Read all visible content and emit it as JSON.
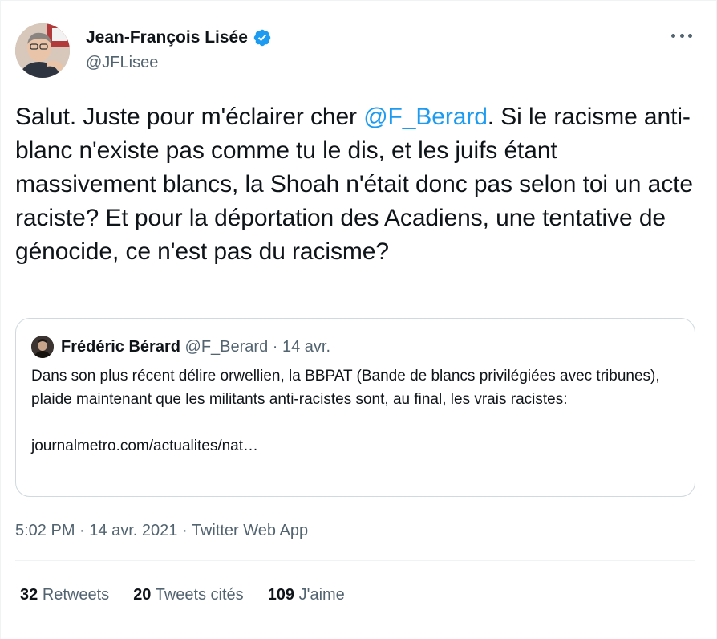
{
  "author": {
    "name": "Jean-François Lisée",
    "handle": "@JFLisee",
    "verified_icon": "verified-badge-icon",
    "verified_color": "#1d9bf0"
  },
  "tweet": {
    "text_before": "Salut. Juste pour m'éclairer cher ",
    "mention": "@F_Berard",
    "text_after": ". Si le racisme anti-blanc n'existe pas comme tu le dis, et les juifs étant massivement blancs, la Shoah n'était donc pas selon toi un acte raciste? Et pour la déportation des Acadiens, une tentative de génocide, ce n'est pas du racisme?"
  },
  "quote": {
    "name": "Frédéric Bérard",
    "handle": "@F_Berard",
    "separator": "·",
    "date": "14 avr.",
    "text": "Dans son plus récent délire orwellien, la BBPAT (Bande de blancs privilégiées avec tribunes), plaide maintenant que les militants anti-racistes sont, au final, les vrais racistes:",
    "link": "journalmetro.com/actualites/nat…"
  },
  "meta": {
    "time": "5:02 PM",
    "sep1": "·",
    "date": "14 avr. 2021",
    "sep2": "·",
    "source": "Twitter Web App"
  },
  "stats": {
    "retweets_count": "32",
    "retweets_label": "Retweets",
    "quotes_count": "20",
    "quotes_label": "Tweets cités",
    "likes_count": "109",
    "likes_label": "J'aime"
  },
  "colors": {
    "accent": "#1d9bf0",
    "secondary_text": "#536471",
    "primary_text": "#0f1419",
    "border": "#cfd9de"
  }
}
